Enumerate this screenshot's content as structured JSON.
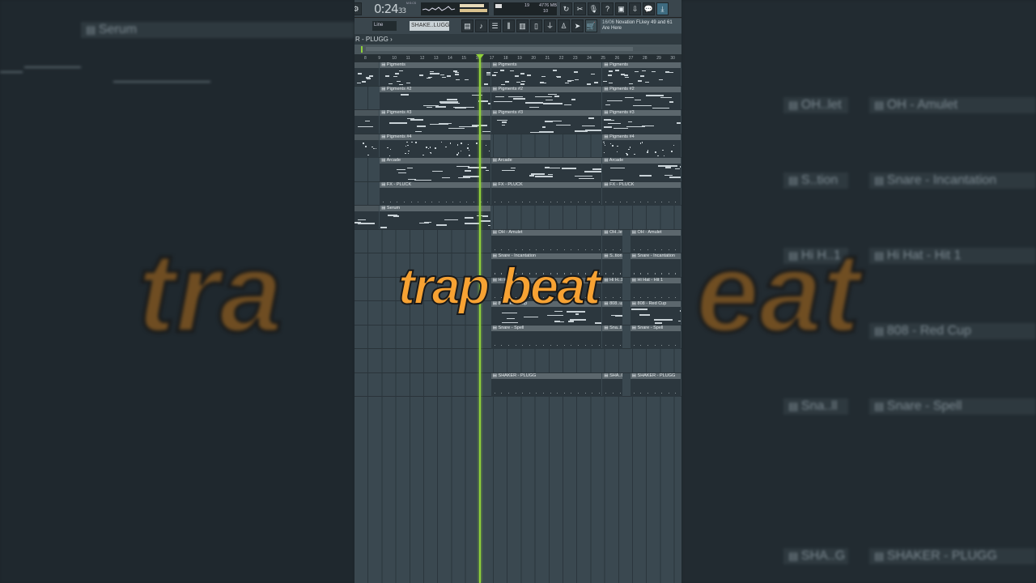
{
  "overlay": {
    "title": "trap beat",
    "bg_left": "tra",
    "bg_right": "eat"
  },
  "toolbar": {
    "time": "0:24",
    "time_small": "33",
    "time_unit": "M:S:CS",
    "cpu": "19",
    "memory": "4776 MB",
    "polyphony": "10",
    "snap": "Line",
    "pattern": "SHAKE..LUGG",
    "hint_date": "16/06",
    "hint_text": "Novation FLkey 49 and 61 Are Here",
    "icons": [
      "undo-icon",
      "cut-icon",
      "mic-icon",
      "help-icon",
      "save-icon",
      "export-icon",
      "chat-icon",
      "download-icon"
    ]
  },
  "breadcrumb": "R - PLUGG ›",
  "ruler": [
    8,
    9,
    10,
    11,
    12,
    13,
    14,
    15,
    16,
    17,
    18,
    19,
    20,
    21,
    22,
    23,
    24,
    25,
    26,
    27,
    28,
    29,
    30
  ],
  "colors": {
    "playhead": "#8fd13a",
    "title": "#f7a233"
  },
  "tracks": [
    {
      "name": "Pigments",
      "dense": 3,
      "clips": [
        {
          "s": 7.2,
          "e": 9,
          "label": ""
        },
        {
          "s": 9,
          "e": 17,
          "label": "Pigments"
        },
        {
          "s": 17,
          "e": 25,
          "label": "Pigments"
        },
        {
          "s": 25,
          "e": 31,
          "label": "Pigments"
        }
      ]
    },
    {
      "name": "Pigments #2",
      "dense": 1,
      "clips": [
        {
          "s": 9,
          "e": 17,
          "label": "Pigments #2"
        },
        {
          "s": 17,
          "e": 25,
          "label": "Pigments #2"
        },
        {
          "s": 25,
          "e": 31,
          "label": "Pigments #2"
        }
      ]
    },
    {
      "name": "Pigments #3",
      "dense": 1,
      "clips": [
        {
          "s": 7.2,
          "e": 9,
          "label": ""
        },
        {
          "s": 9,
          "e": 17,
          "label": "Pigments #3"
        },
        {
          "s": 17,
          "e": 25,
          "label": "Pigments #3"
        },
        {
          "s": 25,
          "e": 31,
          "label": "Pigments #3"
        }
      ]
    },
    {
      "name": "Pigments #4",
      "dense": 4,
      "clips": [
        {
          "s": 7.2,
          "e": 9,
          "label": ""
        },
        {
          "s": 9,
          "e": 17,
          "label": "Pigments #4"
        },
        {
          "s": 25,
          "e": 31,
          "label": "Pigments #4"
        }
      ]
    },
    {
      "name": "Arcade",
      "dense": 2,
      "clips": [
        {
          "s": 9,
          "e": 17,
          "label": "Arcade"
        },
        {
          "s": 17,
          "e": 25,
          "label": "Arcade"
        },
        {
          "s": 25,
          "e": 31,
          "label": "Arcade"
        }
      ]
    },
    {
      "name": "FX - PLUCK",
      "dense": 0,
      "clips": [
        {
          "s": 9,
          "e": 17,
          "label": "FX - PLUCK"
        },
        {
          "s": 17,
          "e": 25,
          "label": "FX - PLUCK"
        },
        {
          "s": 25,
          "e": 31,
          "label": "FX - PLUCK"
        }
      ]
    },
    {
      "name": "Serum",
      "dense": 1,
      "clips": [
        {
          "s": 7.2,
          "e": 9,
          "label": ""
        },
        {
          "s": 9,
          "e": 17,
          "label": "Serum"
        }
      ]
    },
    {
      "name": "OH - Amulet",
      "dense": 0,
      "clips": [
        {
          "s": 17,
          "e": 25,
          "label": "OH - Amulet"
        },
        {
          "s": 25,
          "e": 26.5,
          "label": "OH..let"
        },
        {
          "s": 27,
          "e": 31,
          "label": "OH - Amulet"
        }
      ]
    },
    {
      "name": "Snare - Incantation",
      "dense": 0,
      "clips": [
        {
          "s": 17,
          "e": 25,
          "label": "Snare - Incantation"
        },
        {
          "s": 25,
          "e": 26.5,
          "label": "S..tion"
        },
        {
          "s": 27,
          "e": 31,
          "label": "Snare - Incantation"
        }
      ]
    },
    {
      "name": "Hi Hat - Hit 1",
      "dense": 0,
      "clips": [
        {
          "s": 17,
          "e": 25,
          "label": "Hi Hat - Hit 1"
        },
        {
          "s": 25,
          "e": 26.5,
          "label": "Hi H..1"
        },
        {
          "s": 27,
          "e": 31,
          "label": "Hi Hat - Hit 1"
        }
      ]
    },
    {
      "name": "808 - Red Cup",
      "dense": 1,
      "clips": [
        {
          "s": 17,
          "e": 25,
          "label": "808 - Red Cup"
        },
        {
          "s": 25,
          "e": 26.5,
          "label": "808..up"
        },
        {
          "s": 27,
          "e": 31,
          "label": "808 - Red Cup"
        }
      ]
    },
    {
      "name": "Snare - Spell",
      "dense": 0,
      "clips": [
        {
          "s": 17,
          "e": 25,
          "label": "Snare - Spell"
        },
        {
          "s": 25,
          "e": 26.5,
          "label": "Sna..ll"
        },
        {
          "s": 27,
          "e": 31,
          "label": "Snare - Spell"
        }
      ]
    },
    {
      "name": "",
      "dense": 0,
      "clips": []
    },
    {
      "name": "SHAKER - PLUGG",
      "dense": 0,
      "clips": [
        {
          "s": 17,
          "e": 25,
          "label": "SHAKER - PLUGG"
        },
        {
          "s": 25,
          "e": 26.5,
          "label": "SHA..G"
        },
        {
          "s": 27,
          "e": 31,
          "label": "SHAKER - PLUGG"
        }
      ]
    }
  ],
  "background": {
    "left_labels": [
      "Serum"
    ],
    "right_labels": [
      [
        "OH..let",
        "OH - Amulet"
      ],
      [
        "S..tion",
        "Snare - Incantation"
      ],
      [
        "Hi H..1",
        "Hi Hat - Hit 1"
      ],
      [
        "",
        "808 - Red Cup"
      ],
      [
        "Sna..ll",
        "Snare - Spell"
      ],
      [
        "SHA..G",
        "SHAKER - PLUGG"
      ]
    ]
  }
}
